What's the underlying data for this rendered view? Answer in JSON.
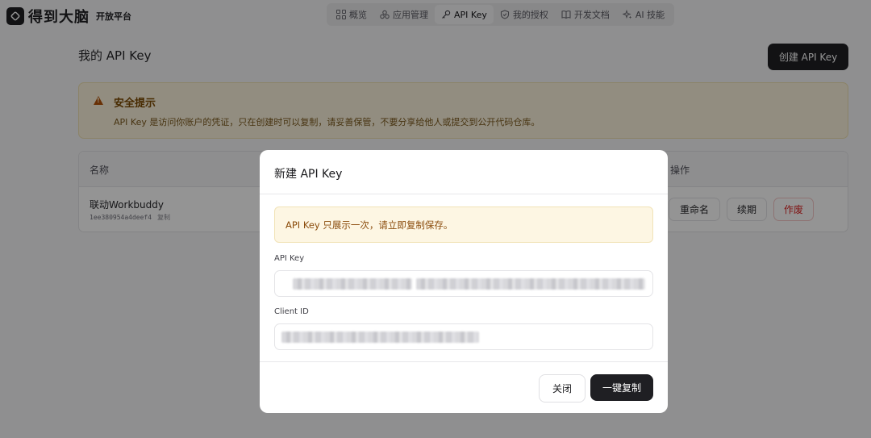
{
  "brand": {
    "name": "得到大脑",
    "subtitle": "开放平台"
  },
  "nav": {
    "items": [
      {
        "label": "概览",
        "icon": "grid-icon"
      },
      {
        "label": "应用管理",
        "icon": "apps-icon"
      },
      {
        "label": "API Key",
        "icon": "key-icon",
        "active": true
      },
      {
        "label": "我的授权",
        "icon": "shield-icon"
      },
      {
        "label": "开发文档",
        "icon": "book-icon"
      },
      {
        "label": "AI 技能",
        "icon": "sparkle-icon"
      }
    ]
  },
  "page": {
    "title": "我的 API Key",
    "create_label": "创建 API Key"
  },
  "warning": {
    "title": "安全提示",
    "text": "API Key 是访问你账户的凭证，只在创建时可以复制，请妥善保管，不要分享给他人或提交到公开代码仓库。"
  },
  "table": {
    "headers": {
      "name": "名称",
      "ops": "操作"
    },
    "rows": [
      {
        "name": "联动Workbuddy",
        "id": "1ee380954a4deef4",
        "copy_label": "复制",
        "actions": [
          "重命名",
          "续期",
          "作废"
        ]
      }
    ]
  },
  "modal": {
    "title": "新建 API Key",
    "notice": "API Key 只展示一次，请立即复制保存。",
    "api_key_label": "API Key",
    "client_id_label": "Client ID",
    "close_label": "关闭",
    "copy_all_label": "一键复制"
  },
  "colors": {
    "primary_dark": "#1f1f23",
    "warning_bg": "#fbf3dc",
    "danger": "#dc2626"
  }
}
